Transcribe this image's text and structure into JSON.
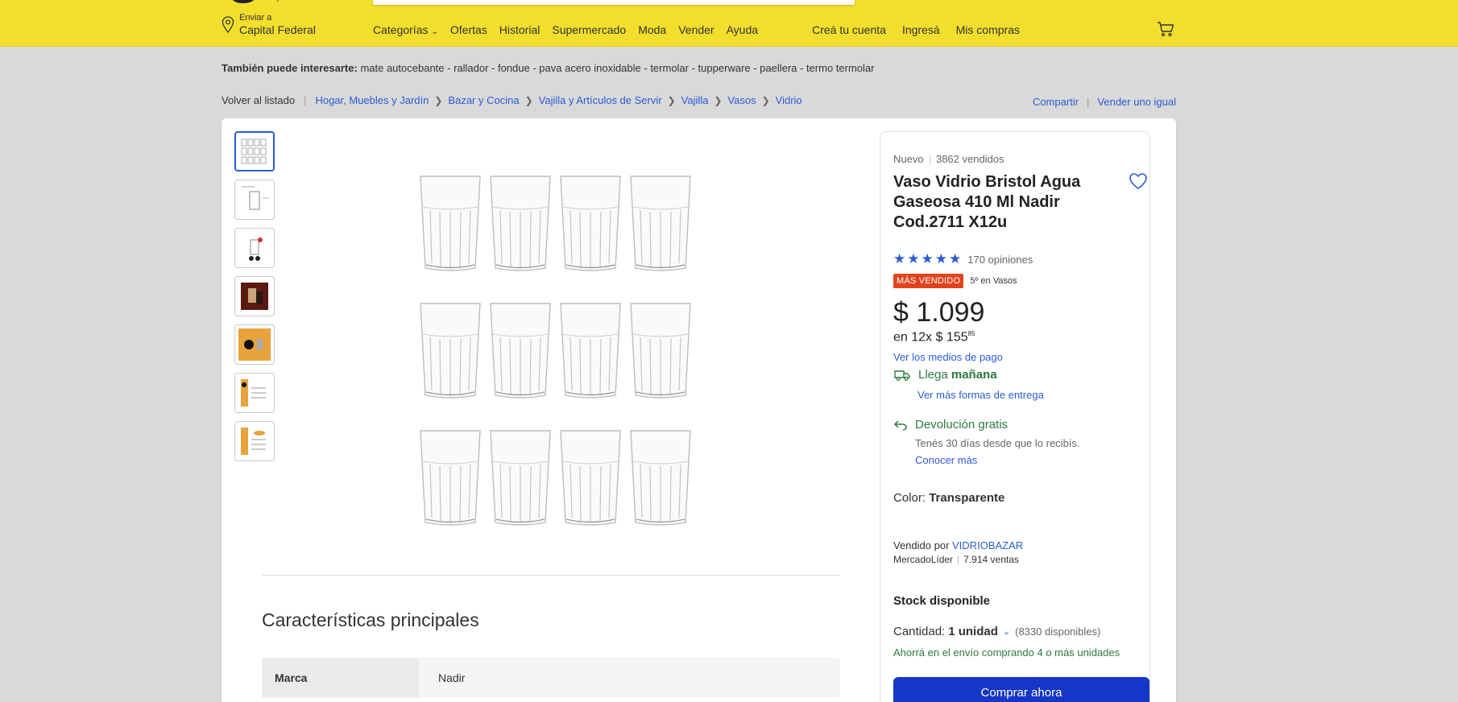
{
  "header": {
    "logo_sub": "hoy",
    "location_small": "Enviar a",
    "location_big": "Capital Federal",
    "nav": [
      "Categorías",
      "Ofertas",
      "Historial",
      "Supermercado",
      "Moda",
      "Vender",
      "Ayuda"
    ],
    "account": [
      "Creá tu cuenta",
      "Ingresá",
      "Mis compras"
    ]
  },
  "suggestions": {
    "label": "También puede interesarte:",
    "items": "mate autocebante - rallador - fondue - pava acero inoxidable - termolar - tupperware - paellera - termo termolar"
  },
  "breadcrumb": {
    "back": "Volver al listado",
    "items": [
      "Hogar, Muebles y Jardín",
      "Bazar y Cocina",
      "Vajilla y Artículos de Servir",
      "Vajilla",
      "Vasos",
      "Vidrio"
    ],
    "share": "Compartir",
    "sell": "Vender uno igual"
  },
  "gallery": {
    "thumbnails": 7,
    "glass_rows": 3,
    "glasses_per_row": 4
  },
  "features": {
    "title": "Características principales",
    "rows": [
      {
        "key": "Marca",
        "value": "Nadir"
      }
    ]
  },
  "product": {
    "condition": "Nuevo",
    "sold": "3862 vendidos",
    "title": "Vaso Vidrio Bristol Agua Gaseosa 410 Ml Nadir Cod.2711 X12u",
    "rating": 5,
    "reviews": "170 opiniones",
    "badge": "MÁS VENDIDO",
    "rank": "5º en Vasos",
    "price": "$ 1.099",
    "installments": "en 12x $ 155",
    "installments_cents": "85",
    "payment_link": "Ver los medios de pago",
    "shipping_prefix": "Llega ",
    "shipping_bold": "mañana",
    "shipping_link": "Ver más formas de entrega",
    "return_title": "Devolución gratis",
    "return_sub": "Tenés 30 días desde que lo recibís.",
    "return_link": "Conocer más",
    "color_label": "Color: ",
    "color_value": "Transparente",
    "sold_by": "Vendido por ",
    "seller": "VIDRIOBAZAR",
    "seller_tier": "MercadoLíder",
    "seller_sales": "7.914 ventas",
    "stock": "Stock disponible",
    "qty_label": "Cantidad:",
    "qty_value": "1 unidad",
    "qty_available": "(8330 disponibles)",
    "save_msg": "Ahorrá en el envío comprando 4 o más unidades",
    "buy_button": "Comprar ahora"
  },
  "colors": {
    "header": "#f2de2c",
    "link": "#2a5bd7",
    "badge": "#e2431c",
    "green": "#2c7a3e",
    "button": "#1636c7"
  }
}
